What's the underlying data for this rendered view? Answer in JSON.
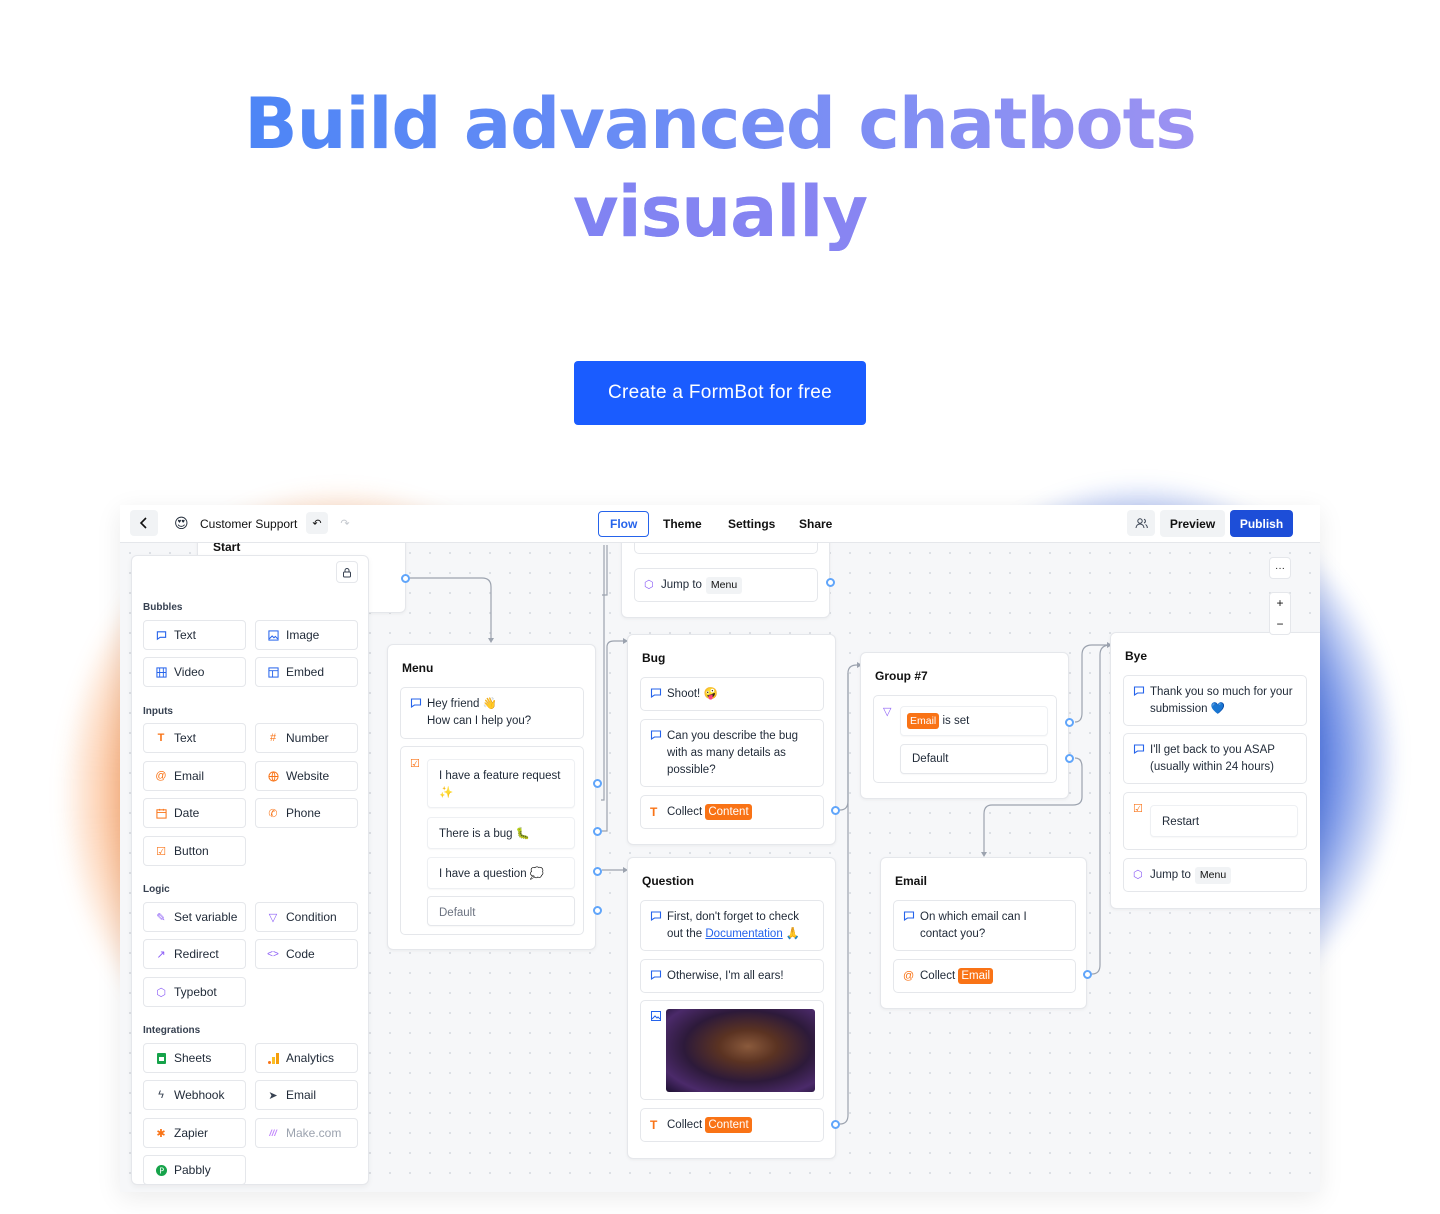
{
  "hero": {
    "title_line1": "Build advanced chatbots",
    "title_line2": "visually",
    "cta": "Create a FormBot  for free"
  },
  "topbar": {
    "back_icon": "chevron-left-icon",
    "bot_emoji": "😍",
    "bot_name": "Customer Support",
    "tabs": [
      "Flow",
      "Theme",
      "Settings",
      "Share"
    ],
    "active_tab": "Flow",
    "preview": "Preview",
    "publish": "Publish"
  },
  "panel": {
    "sections": {
      "bubbles": "Bubbles",
      "inputs": "Inputs",
      "logic": "Logic",
      "integrations": "Integrations"
    },
    "bubbles": [
      {
        "label": "Text",
        "icon": "chat-icon"
      },
      {
        "label": "Image",
        "icon": "image-icon"
      },
      {
        "label": "Video",
        "icon": "film-icon"
      },
      {
        "label": "Embed",
        "icon": "layout-icon"
      }
    ],
    "inputs": [
      {
        "label": "Text",
        "icon": "text-icon"
      },
      {
        "label": "Number",
        "icon": "hash-icon"
      },
      {
        "label": "Email",
        "icon": "at-icon"
      },
      {
        "label": "Website",
        "icon": "globe-icon"
      },
      {
        "label": "Date",
        "icon": "calendar-icon"
      },
      {
        "label": "Phone",
        "icon": "phone-icon"
      },
      {
        "label": "Button",
        "icon": "checkbox-icon"
      }
    ],
    "logic": [
      {
        "label": "Set variable",
        "icon": "pen-icon"
      },
      {
        "label": "Condition",
        "icon": "filter-icon"
      },
      {
        "label": "Redirect",
        "icon": "external-link-icon"
      },
      {
        "label": "Code",
        "icon": "code-icon"
      },
      {
        "label": "Typebot",
        "icon": "cube-icon"
      }
    ],
    "integrations": [
      {
        "label": "Sheets",
        "icon": "sheets-icon"
      },
      {
        "label": "Analytics",
        "icon": "analytics-icon"
      },
      {
        "label": "Webhook",
        "icon": "bolt-icon"
      },
      {
        "label": "Email",
        "icon": "send-icon"
      },
      {
        "label": "Zapier",
        "icon": "zapier-icon"
      },
      {
        "label": "Make.com",
        "icon": "make-icon"
      },
      {
        "label": "Pabbly",
        "icon": "pabbly-icon"
      }
    ]
  },
  "canvas": {
    "start": {
      "title": "Start"
    },
    "top_group": {
      "jump_label": "Jump to",
      "jump_target": "Menu"
    },
    "menu": {
      "title": "Menu",
      "greeting_l1": "Hey friend 👋",
      "greeting_l2": "How can I help you?",
      "choices": [
        "I have a feature request ✨",
        "There is a bug 🐛",
        "I have a question 💭"
      ],
      "default": "Default"
    },
    "bug": {
      "title": "Bug",
      "msg1": "Shoot! 🤪",
      "msg2": "Can you describe the bug with as many details as possible?",
      "collect": "Collect",
      "var": "Content"
    },
    "question": {
      "title": "Question",
      "msg1_pre": "First, don't forget to check out the ",
      "msg1_link": "Documentation",
      "msg1_post": " 🙏",
      "msg2": "Otherwise, I'm all ears!",
      "collect": "Collect",
      "var": "Content"
    },
    "group7": {
      "title": "Group #7",
      "cond_var": "Email",
      "cond_text": "is set",
      "default": "Default"
    },
    "email": {
      "title": "Email",
      "msg": "On which email can I contact you?",
      "collect": "Collect",
      "var": "Email"
    },
    "bye": {
      "title": "Bye",
      "msg1": "Thank you so much for your submission 💙",
      "msg2": "I'll get back to you ASAP (usually within 24 hours)",
      "restart": "Restart",
      "jump_label": "Jump to",
      "jump_target": "Menu"
    },
    "controls": {
      "more": "···",
      "zoom_in": "+",
      "zoom_out": "−"
    }
  },
  "colors": {
    "accent": "#1a5cff",
    "orange": "#f97316",
    "connector": "#60a5fa"
  }
}
